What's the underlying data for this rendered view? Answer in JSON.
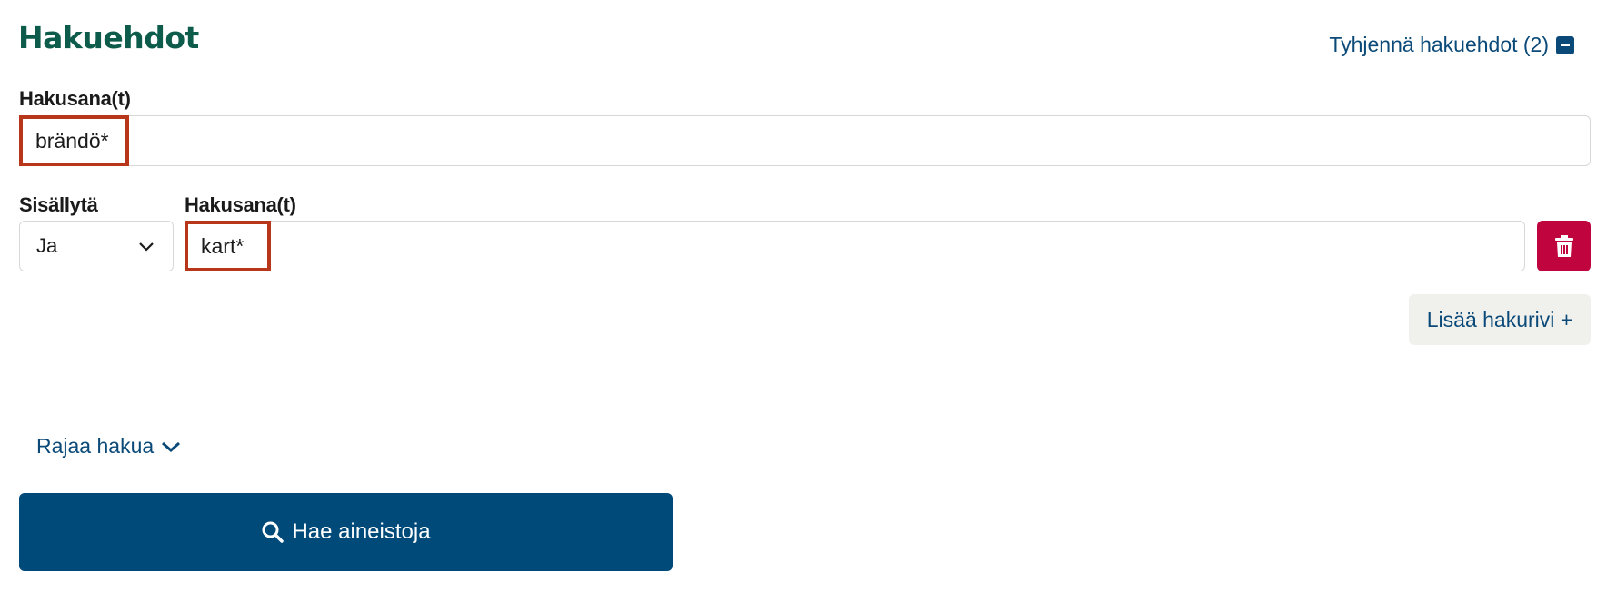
{
  "header": {
    "title": "Hakuehdot",
    "clear_label": "Tyhjennä hakuehdot (2)"
  },
  "row1": {
    "label": "Hakusana(t)",
    "value": "brändö*"
  },
  "row2": {
    "include_label": "Sisällytä",
    "include_value": "Ja",
    "label": "Hakusana(t)",
    "value": "kart*"
  },
  "actions": {
    "add_row_label": "Lisää hakurivi +",
    "refine_label": "Rajaa hakua",
    "search_label": "Hae aineistoja"
  },
  "icons": {
    "clear": "minus-square-icon",
    "dropdown": "chevron-down-icon",
    "delete": "trash-icon",
    "refine": "chevron-down-icon",
    "search": "search-icon"
  },
  "colors": {
    "title": "#0d5b4a",
    "link": "#0b4a78",
    "primary_button": "#004a7a",
    "delete_button": "#c0053e",
    "highlight_border": "#b8361a"
  }
}
